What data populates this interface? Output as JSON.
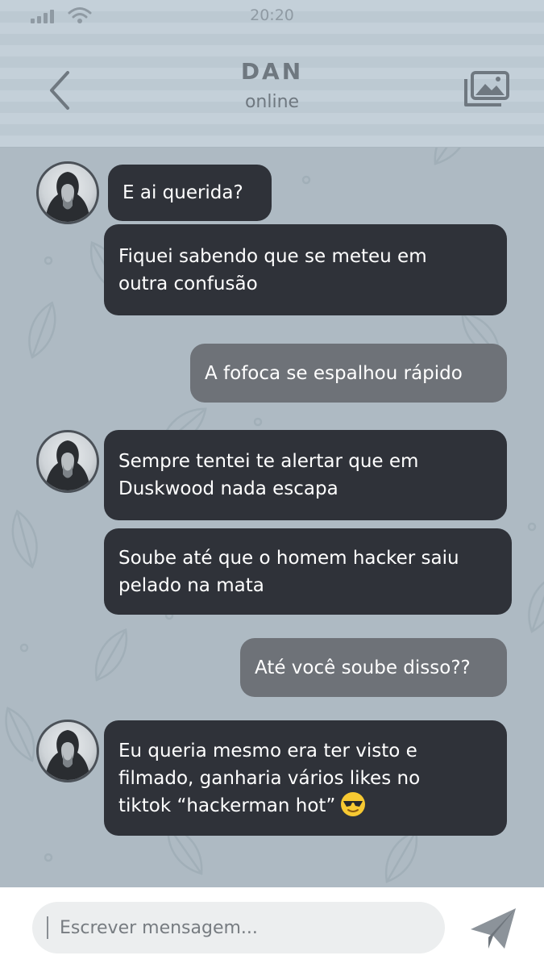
{
  "status_bar": {
    "time": "20:20"
  },
  "header": {
    "contact_name": "DAN",
    "contact_status": "online"
  },
  "icons": {
    "back": "chevron-left-icon",
    "gallery": "gallery-icon",
    "send": "paper-plane-icon",
    "emoji": "smiling-face-with-sunglasses"
  },
  "messages": [
    {
      "sender": "contact",
      "lines": [
        "E ai querida?"
      ]
    },
    {
      "sender": "contact",
      "lines": [
        "Fiquei sabendo que se meteu em",
        "outra confusão"
      ]
    },
    {
      "sender": "user",
      "lines": [
        "A fofoca se espalhou rápido"
      ]
    },
    {
      "sender": "contact",
      "lines": [
        "Sempre tentei te alertar que em",
        "Duskwood nada escapa"
      ]
    },
    {
      "sender": "contact",
      "lines": [
        "Soube até que o homem hacker saiu",
        "pelado na mata"
      ]
    },
    {
      "sender": "user",
      "lines": [
        "Até você soube disso??"
      ]
    },
    {
      "sender": "contact",
      "lines": [
        "Eu queria mesmo era ter visto e",
        "filmado, ganharia vários likes no",
        "tiktok “hackerman hot”"
      ]
    }
  ],
  "composer": {
    "placeholder": "Escrever mensagem..."
  },
  "colors": {
    "incoming_bubble": "#2f3239",
    "outgoing_bubble": "#6e7278",
    "chat_background": "#aebac3",
    "header_background": "#c4d0d9"
  }
}
